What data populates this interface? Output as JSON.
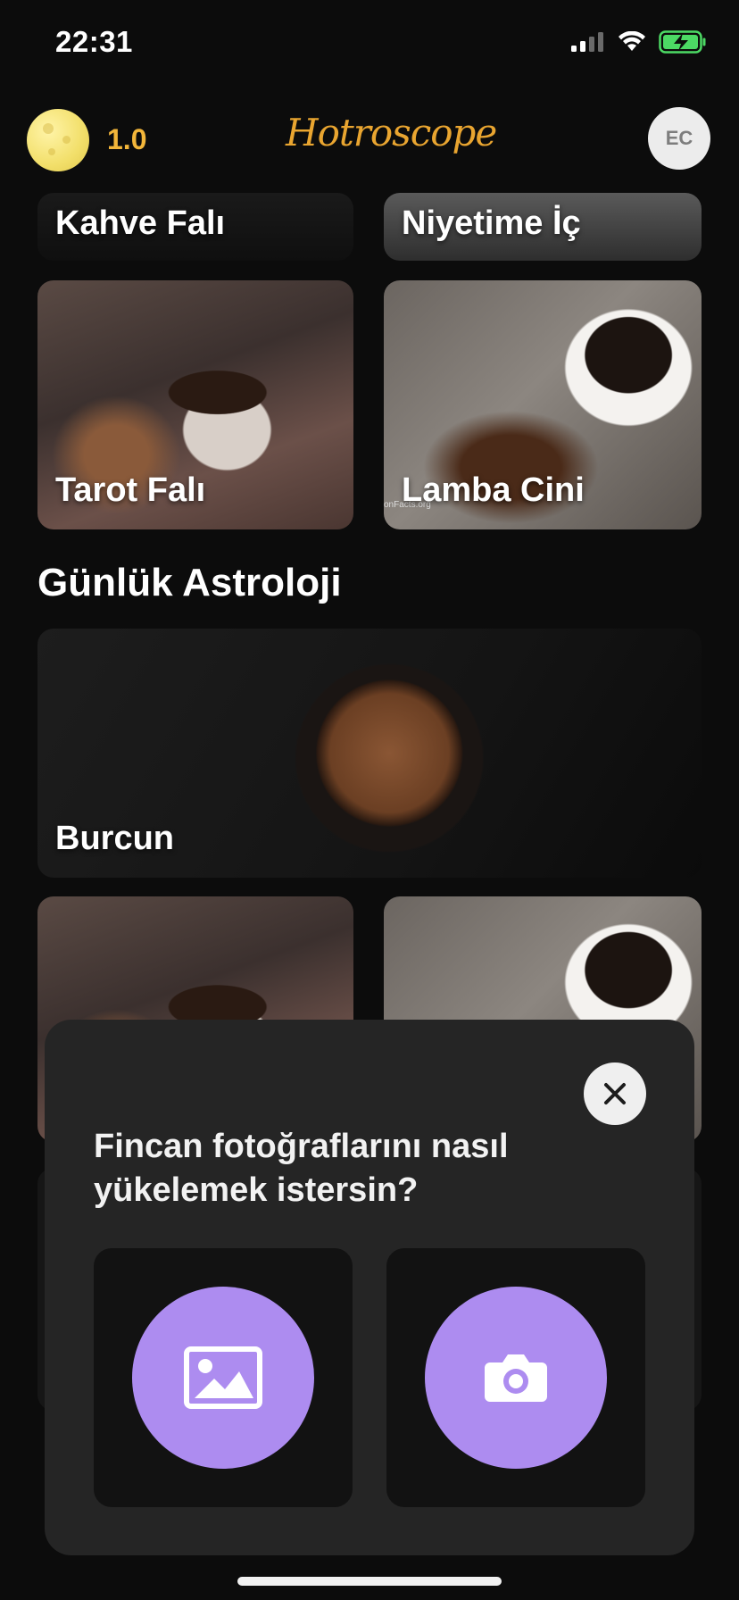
{
  "status_bar": {
    "time": "22:31"
  },
  "header": {
    "moon_value": "1.0",
    "app_title": "Hotroscope",
    "avatar_initials": "EC"
  },
  "cards_top": [
    {
      "label": "Kahve Falı"
    },
    {
      "label": "Niyetime İç"
    },
    {
      "label": "Tarot Falı"
    },
    {
      "label": "Lamba Cini",
      "watermark": "onFacts.org"
    }
  ],
  "section": {
    "title": "Günlük Astroloji"
  },
  "cards_astro": [
    {
      "label": "Burcun"
    }
  ],
  "modal": {
    "title": "Fincan fotoğraflarını nasıl yükelemek istersin?",
    "options": [
      {
        "icon": "image-icon"
      },
      {
        "icon": "camera-icon"
      }
    ]
  },
  "colors": {
    "accent": "#ad8cf0",
    "gold": "#e9a530",
    "background": "#0c0c0c",
    "modal": "#252525"
  }
}
